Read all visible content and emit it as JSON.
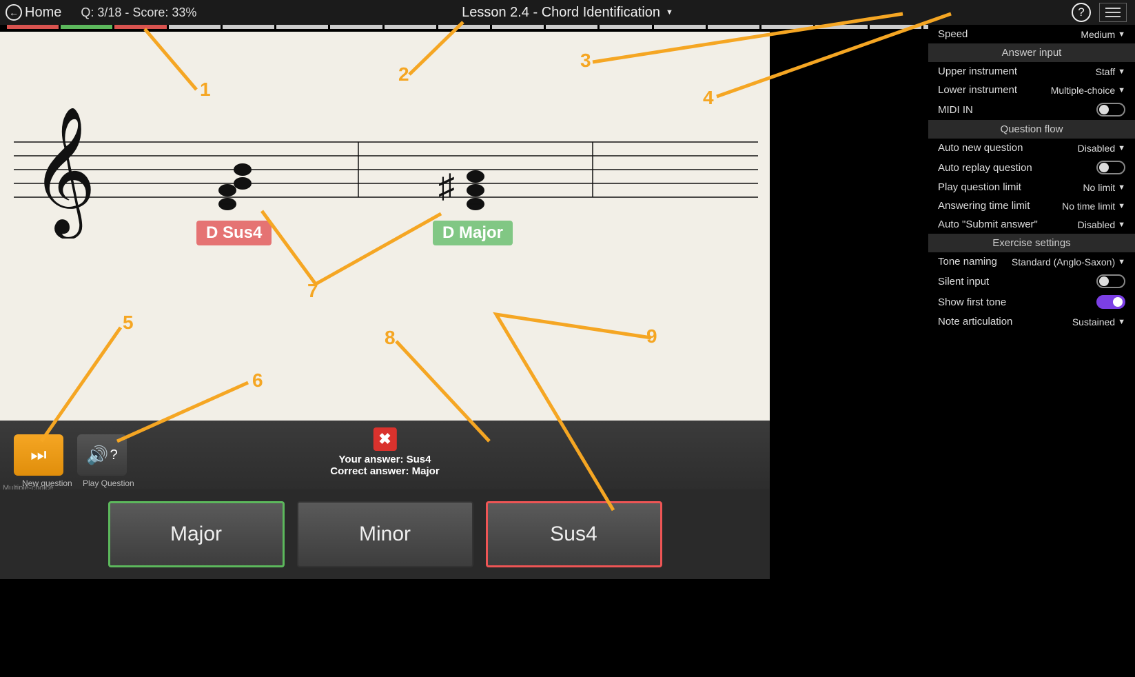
{
  "header": {
    "home_label": "Home",
    "score_text": "Q: 3/18 - Score: 33%",
    "lesson_title": "Lesson 2.4 - Chord Identification"
  },
  "progress": {
    "total_segments": 18,
    "results": [
      "red",
      "green",
      "red"
    ]
  },
  "staff": {
    "your_chord_label": "D Sus4",
    "correct_chord_label": "D Major"
  },
  "controls": {
    "new_question_caption": "New question",
    "play_question_caption": "Play Question",
    "your_answer_line": "Your answer: Sus4",
    "correct_answer_line": "Correct answer: Major",
    "mc_label": "Multiple-choice"
  },
  "answers": {
    "options": [
      "Major",
      "Minor",
      "Sus4"
    ],
    "correct_index": 0,
    "selected_index": 2
  },
  "settings": {
    "speed_label": "Speed",
    "speed_value": "Medium",
    "section_answer_input": "Answer input",
    "upper_instrument_label": "Upper instrument",
    "upper_instrument_value": "Staff",
    "lower_instrument_label": "Lower instrument",
    "lower_instrument_value": "Multiple-choice",
    "midi_in_label": "MIDI IN",
    "midi_in_on": false,
    "section_question_flow": "Question flow",
    "auto_new_q_label": "Auto new question",
    "auto_new_q_value": "Disabled",
    "auto_replay_label": "Auto replay question",
    "auto_replay_on": false,
    "play_limit_label": "Play question limit",
    "play_limit_value": "No limit",
    "ans_time_label": "Answering time limit",
    "ans_time_value": "No time limit",
    "auto_submit_label": "Auto \"Submit answer\"",
    "auto_submit_value": "Disabled",
    "section_exercise": "Exercise settings",
    "tone_naming_label": "Tone naming",
    "tone_naming_value": "Standard (Anglo-Saxon)",
    "silent_input_label": "Silent input",
    "silent_input_on": false,
    "show_first_tone_label": "Show first tone",
    "show_first_tone_on": true,
    "note_artic_label": "Note articulation",
    "note_artic_value": "Sustained"
  },
  "annotations": {
    "n1": "1",
    "n2": "2",
    "n3": "3",
    "n4": "4",
    "n5": "5",
    "n6": "6",
    "n7": "7",
    "n8": "8",
    "n9": "9"
  }
}
